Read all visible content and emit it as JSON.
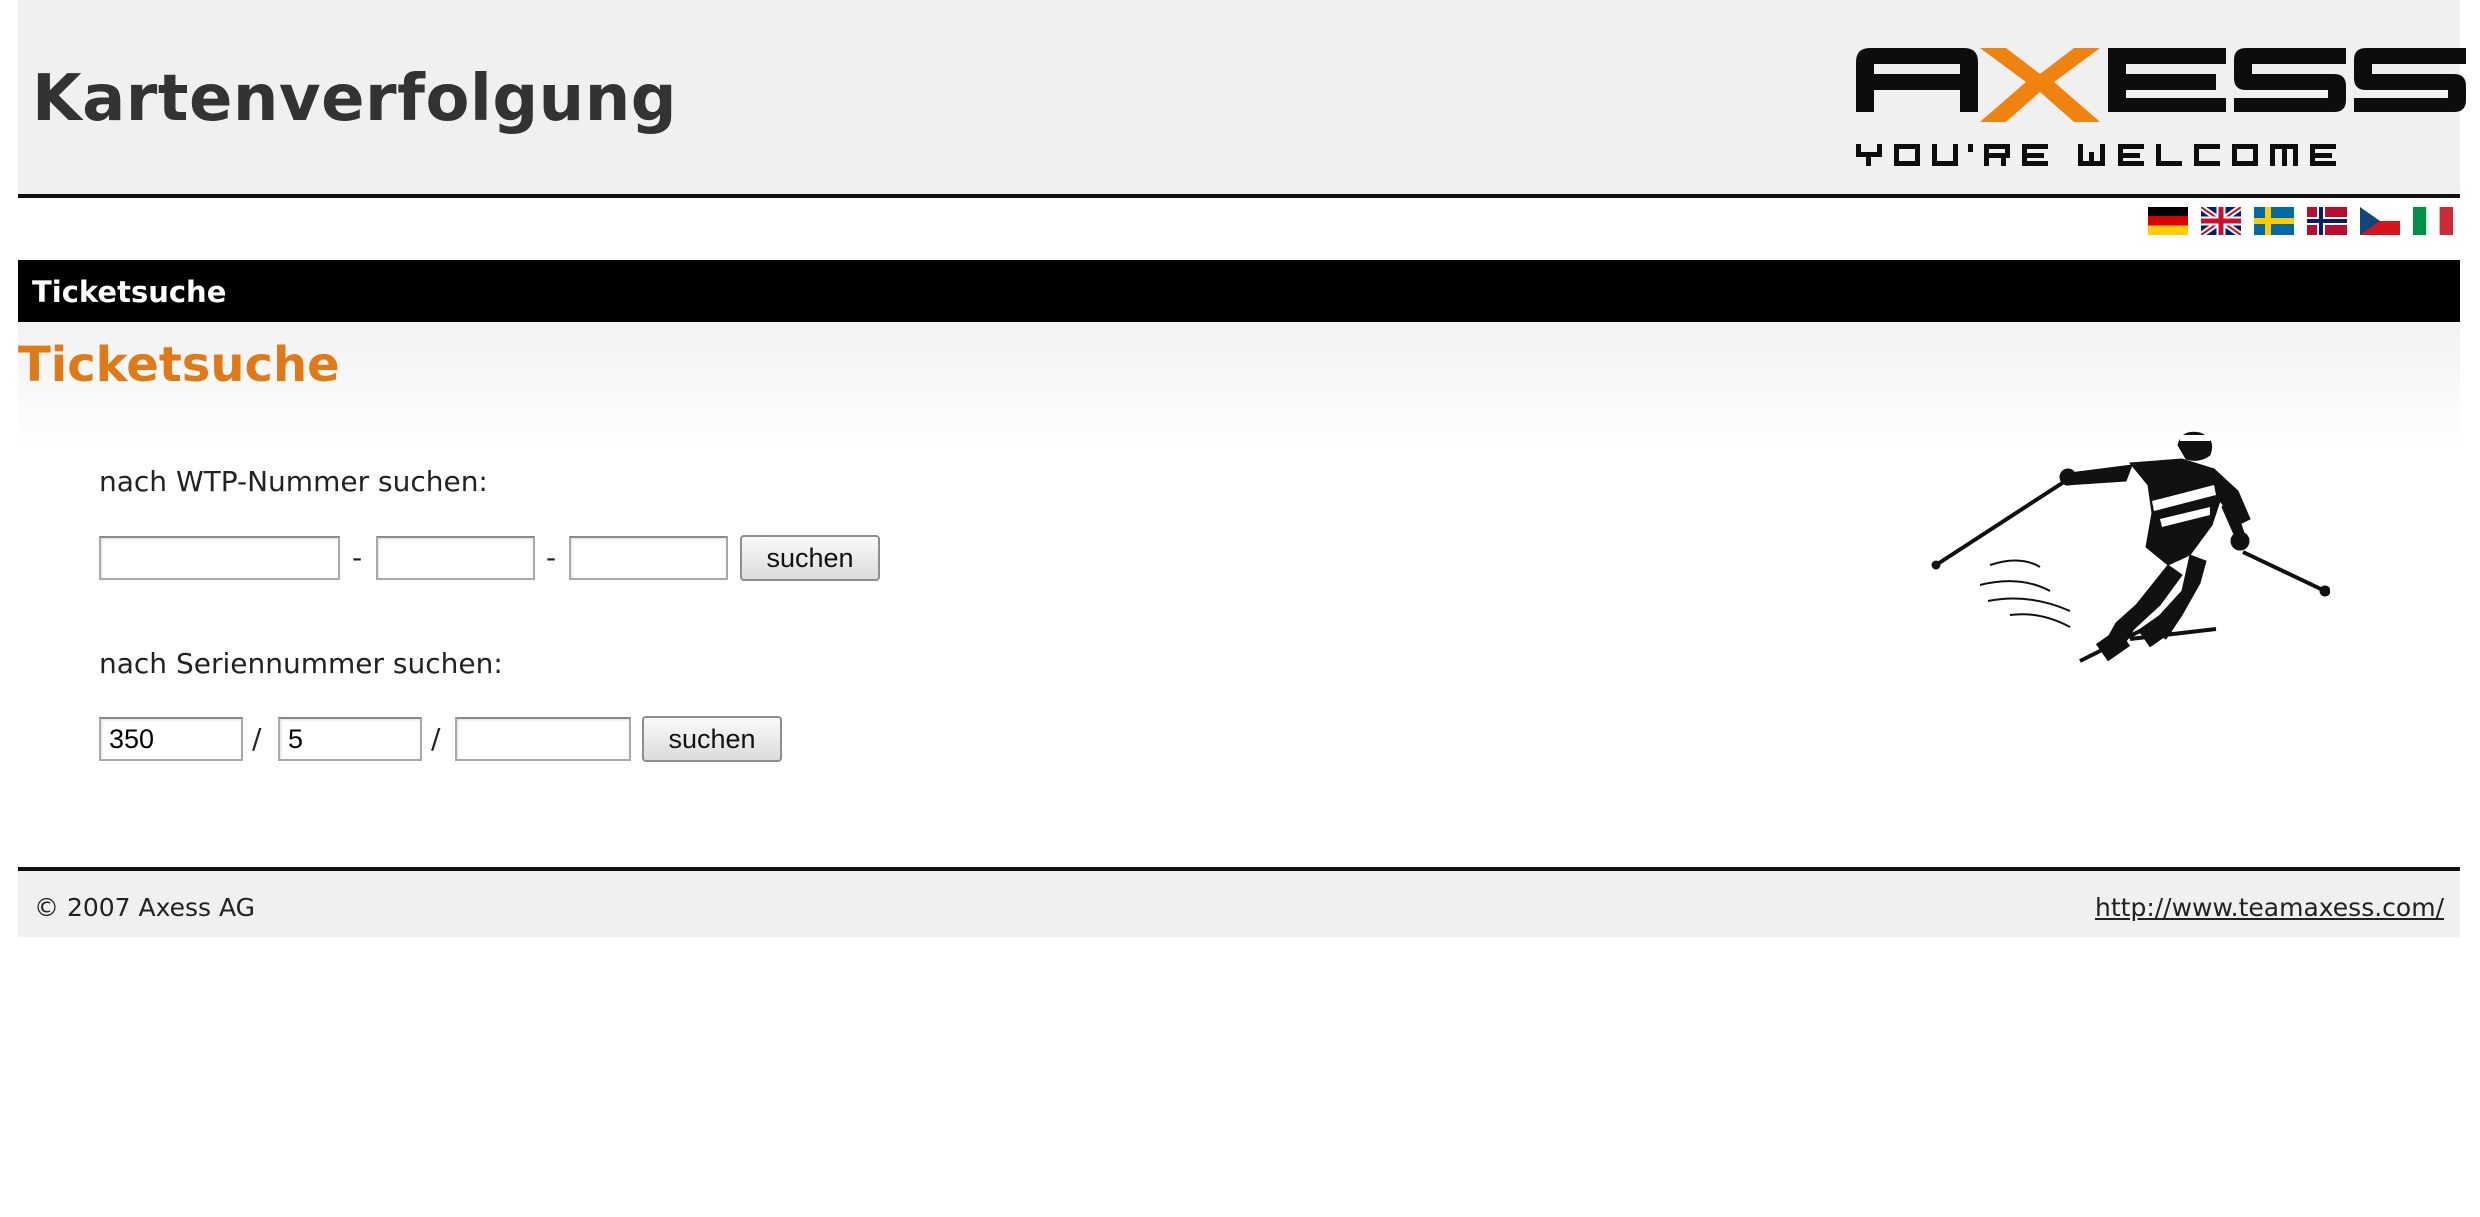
{
  "header": {
    "title": "Kartenverfolgung",
    "logo_text": "AXESS",
    "logo_tagline": "YOU'RE WELCOME",
    "logo_accent_color": "#f0820f"
  },
  "languages": [
    {
      "code": "de",
      "icon": "german-flag-icon"
    },
    {
      "code": "en",
      "icon": "uk-flag-icon"
    },
    {
      "code": "sv",
      "icon": "swedish-flag-icon"
    },
    {
      "code": "no",
      "icon": "norwegian-flag-icon"
    },
    {
      "code": "cs",
      "icon": "czech-flag-icon"
    },
    {
      "code": "it",
      "icon": "italian-flag-icon"
    }
  ],
  "nav": {
    "active_label": "Ticketsuche"
  },
  "main": {
    "title": "Ticketsuche",
    "title_color": "#e07a17",
    "wtp_search": {
      "label": "nach WTP-Nummer suchen:",
      "field1_value": "",
      "field2_value": "",
      "field3_value": "",
      "separator": "-",
      "button_label": "suchen"
    },
    "serial_search": {
      "label": "nach Seriennummer suchen:",
      "field1_value": "350",
      "field2_value": "5",
      "field3_value": "",
      "separator": "/",
      "button_label": "suchen"
    },
    "illustration": "skier-illustration"
  },
  "footer": {
    "copyright": "© 2007 Axess AG",
    "link_text": "http://www.teamaxess.com/"
  }
}
